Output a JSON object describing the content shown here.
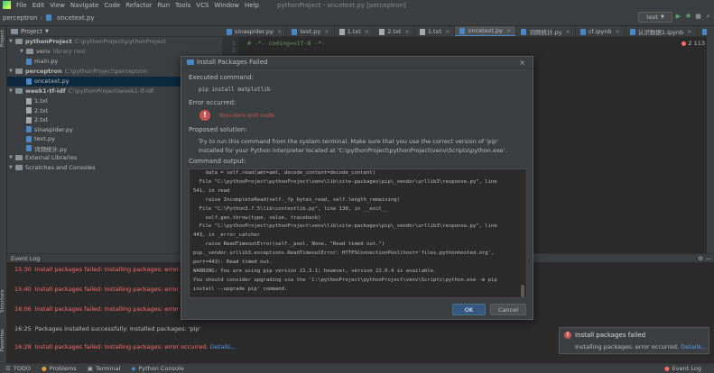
{
  "menu": {
    "items": [
      "File",
      "Edit",
      "View",
      "Navigate",
      "Code",
      "Refactor",
      "Run",
      "Tools",
      "VCS",
      "Window",
      "Help"
    ],
    "window_title": "pythonProject - oncetext.py [perceptron]"
  },
  "navbar": {
    "crumbs": [
      "perceptron",
      "oncetext.py"
    ],
    "run_config": "text"
  },
  "left_strip": {
    "project": "Project",
    "structure": "Structure",
    "favorites": "Favorites"
  },
  "project": {
    "header": "Project",
    "tree": [
      {
        "label": "pythonProject",
        "path": "C:\\pythonProject\\pythonProject",
        "kind": "folder",
        "indent": 0,
        "bold": true
      },
      {
        "label": "venv",
        "path": "library root",
        "kind": "folder",
        "indent": 1,
        "bold": false
      },
      {
        "label": "main.py",
        "path": "",
        "kind": "py",
        "indent": 1,
        "bold": false
      },
      {
        "label": "perceptron",
        "path": "C:\\pythonProject\\perceptron",
        "kind": "folder",
        "indent": 0,
        "bold": true
      },
      {
        "label": "oncetext.py",
        "path": "",
        "kind": "py",
        "indent": 1,
        "bold": false,
        "selected": true
      },
      {
        "label": "week1-tf-idf",
        "path": "C:\\pythonProject\\week1-tf-idf",
        "kind": "folder",
        "indent": 0,
        "bold": true
      },
      {
        "label": "1.txt",
        "path": "",
        "kind": "txt",
        "indent": 1,
        "bold": false
      },
      {
        "label": "2.txt",
        "path": "",
        "kind": "txt",
        "indent": 1,
        "bold": false
      },
      {
        "label": "2.txt",
        "path": "",
        "kind": "txt",
        "indent": 1,
        "bold": false
      },
      {
        "label": "sinaspider.py",
        "path": "",
        "kind": "py",
        "indent": 1,
        "bold": false
      },
      {
        "label": "text.py",
        "path": "",
        "kind": "py",
        "indent": 1,
        "bold": false
      },
      {
        "label": "词频统计.py",
        "path": "",
        "kind": "py",
        "indent": 1,
        "bold": false
      },
      {
        "label": "External Libraries",
        "path": "",
        "kind": "folder",
        "indent": 0,
        "bold": false
      },
      {
        "label": "Scratches and Consoles",
        "path": "",
        "kind": "folder",
        "indent": 0,
        "bold": false
      }
    ]
  },
  "editor": {
    "tabs": [
      "sinaspider.py",
      "text.py",
      "1.txt",
      "2.txt",
      "1.txt",
      "oncetext.py",
      "词频统计.py",
      "cf.ipynb",
      "认识数据1.ipynb",
      "认识数据2.ipy"
    ],
    "active_tab": 5,
    "line_numbers": [
      "1",
      "2"
    ],
    "code_line": "# -*- coding=utf-8 -*-",
    "inspection": "2  113"
  },
  "dialog": {
    "title": "Install Packages Failed",
    "close_glyph": "×",
    "executed_label": "Executed command:",
    "executed_cmd": "pip install matplotlib",
    "error_label": "Error occurred:",
    "error_text": "Non-zero exit code",
    "solution_label": "Proposed solution:",
    "solution_text": "Try to run this command from the system terminal. Make sure that you use the correct version of 'pip' installed for your Python interpreter located at 'C:\\pythonProject\\pythonProject\\venv\\Scripts\\python.exe'.",
    "output_label": "Command output:",
    "output_lines": [
      "    data = self.read(amt=amt, decode_content=decode_content)",
      "  File \"C:\\pythonProject\\pythonProject\\venv\\lib\\site-packages\\pip\\_vendor\\urllib3\\response.py\", line",
      "541, in read",
      "    raise IncompleteRead(self._fp_bytes_read, self.length_remaining)",
      "  File \"C:\\Python3.7.5\\lib\\contextlib.py\", line 130, in __exit__",
      "    self.gen.throw(type, value, traceback)",
      "  File \"C:\\pythonProject\\pythonProject\\venv\\lib\\site-packages\\pip\\_vendor\\urllib3\\response.py\", line",
      "443, in _error_catcher",
      "    raise ReadTimeoutError(self._pool, None, \"Read timed out.\")",
      "pip._vendor.urllib3.exceptions.ReadTimeoutError: HTTPSConnectionPool(host='files.pythonhosted.org',",
      "port=443): Read timed out.",
      "WARNING: You are using pip version 21.3.1; however, version 22.0.4 is available.",
      "You should consider upgrading via the 'C:\\pythonProject\\pythonProject\\venv\\Scripts\\python.exe -m pip",
      "install --upgrade pip' command."
    ],
    "ok": "OK",
    "cancel": "Cancel"
  },
  "eventlog": {
    "title": "Event Log",
    "entries": [
      {
        "time": "15:30",
        "text": "Install packages failed: Installing packages: error occur",
        "kind": "err",
        "link": ""
      },
      {
        "time": "15:40",
        "text": "Install packages failed: Installing packages: error occur",
        "kind": "err",
        "link": ""
      },
      {
        "time": "16:06",
        "text": "Install packages failed: Installing packages: error occur",
        "kind": "err",
        "link": ""
      },
      {
        "time": "16:25",
        "text": "Packages installed successfully: Installed packages: 'pip'",
        "kind": "ok",
        "link": ""
      },
      {
        "time": "16:28",
        "text": "Install packages failed: Installing packages: error occurred.",
        "kind": "err",
        "link": "Details..."
      }
    ]
  },
  "statusbar": {
    "items": [
      "TODO",
      "Problems",
      "Terminal",
      "Python Console"
    ],
    "right": "Event Log"
  },
  "balloon": {
    "title": "Install packages failed",
    "text": "Installing packages: error occurred.",
    "link": "Details..."
  },
  "colors": {
    "error": "#ff6b68",
    "link": "#589df6",
    "accent": "#4a88c7"
  }
}
